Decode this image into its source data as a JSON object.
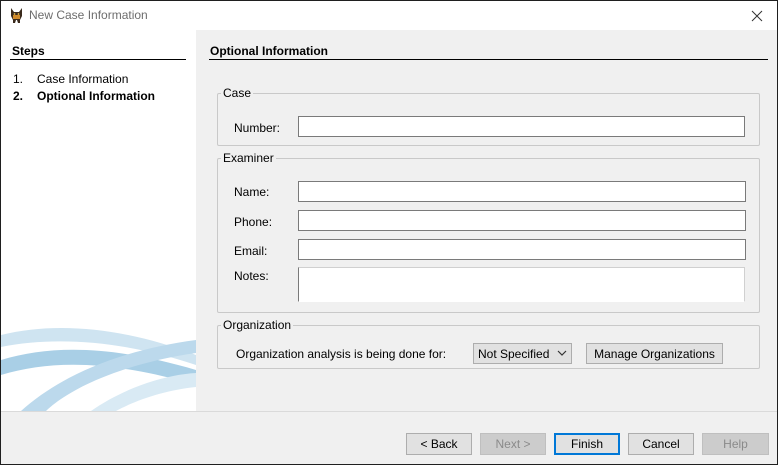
{
  "window": {
    "title": "New Case Information",
    "icon": "autopsy-dog-icon",
    "close_icon": "close-icon"
  },
  "steps": {
    "heading": "Steps",
    "items": [
      {
        "num": "1.",
        "label": "Case Information",
        "current": false
      },
      {
        "num": "2.",
        "label": "Optional Information",
        "current": true
      }
    ]
  },
  "panel": {
    "heading": "Optional Information",
    "case": {
      "legend": "Case",
      "number_label": "Number:",
      "number_value": ""
    },
    "examiner": {
      "legend": "Examiner",
      "name_label": "Name:",
      "name_value": "",
      "phone_label": "Phone:",
      "phone_value": "",
      "email_label": "Email:",
      "email_value": "",
      "notes_label": "Notes:",
      "notes_value": ""
    },
    "organization": {
      "legend": "Organization",
      "analysis_label": "Organization analysis is being done for:",
      "selected": "Not Specified",
      "manage_label": "Manage Organizations"
    }
  },
  "buttons": {
    "back": "< Back",
    "next": "Next >",
    "finish": "Finish",
    "cancel": "Cancel",
    "help": "Help"
  },
  "colors": {
    "window_bg": "#f0f0f0",
    "primary_border": "#0078d7",
    "swoosh": "#a9cfe6"
  }
}
